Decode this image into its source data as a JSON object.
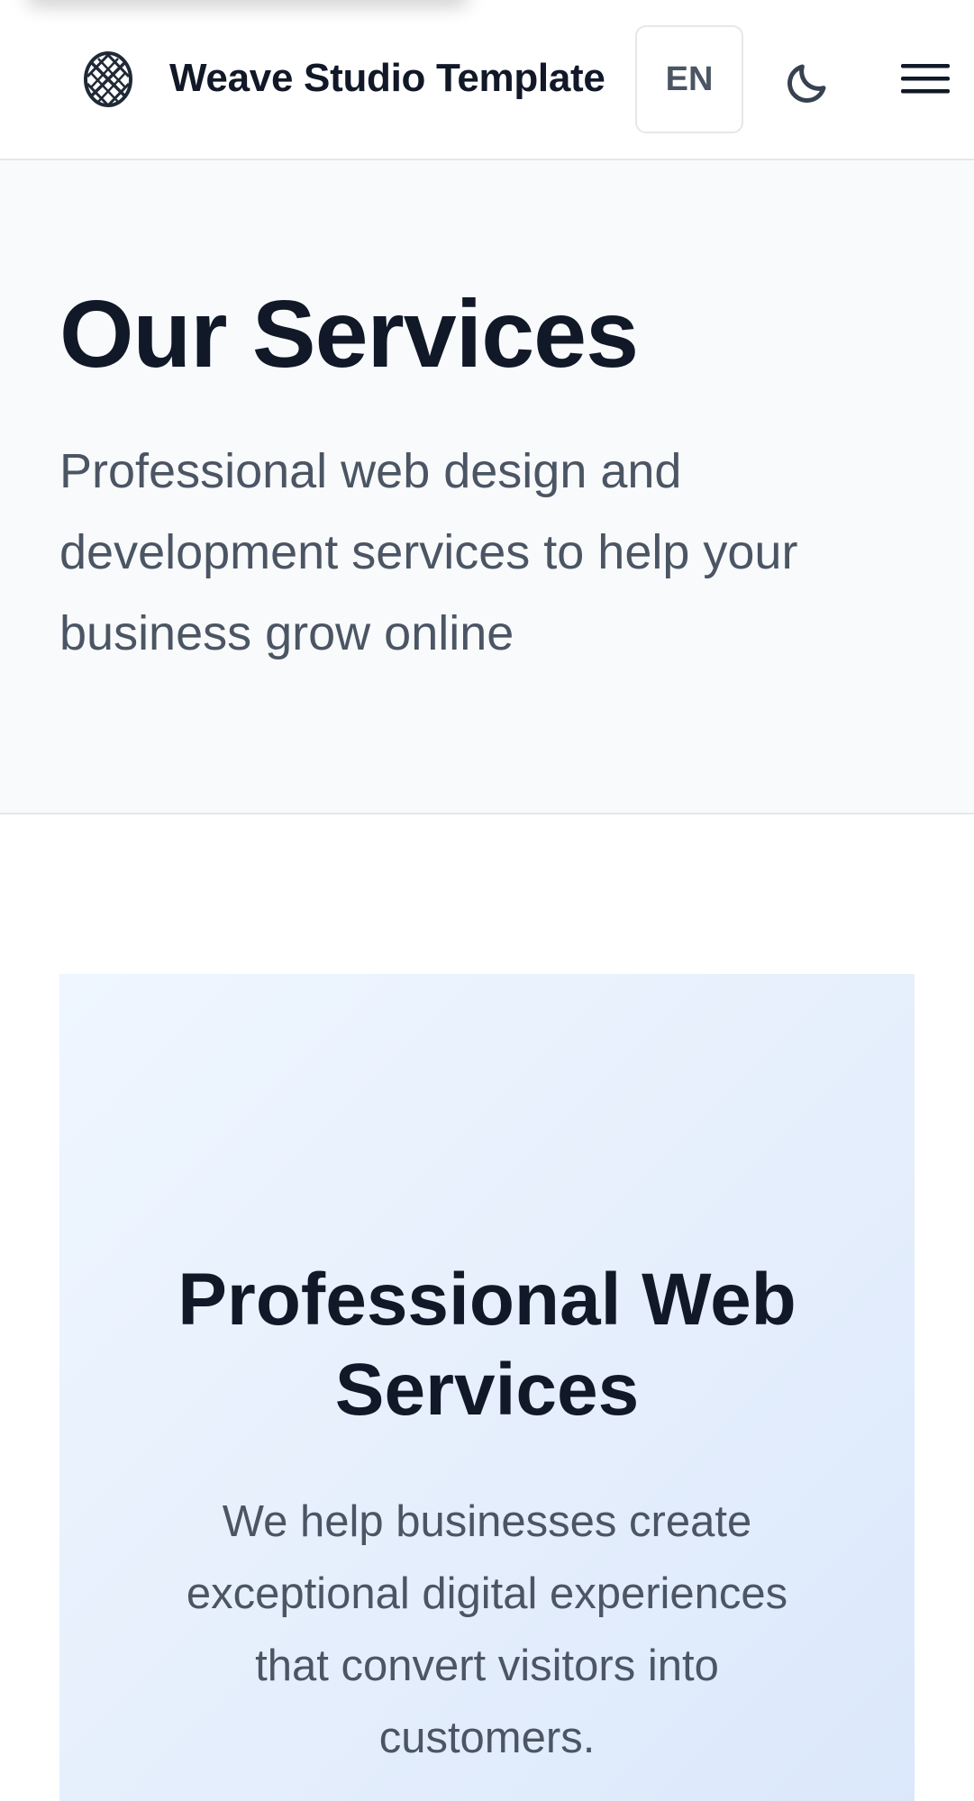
{
  "header": {
    "brand_title": "Weave Studio Template",
    "logo_icon": "woven-globe-icon",
    "language_label": "EN",
    "theme_icon": "moon-icon",
    "menu_icon": "hamburger-menu-icon"
  },
  "hero": {
    "title": "Our Services",
    "subtitle": "Professional web design and development services to help your business grow online"
  },
  "services_card": {
    "title": "Professional Web Services",
    "text": "We help businesses create exceptional digital experiences that convert visitors into customers."
  },
  "colors": {
    "text_primary": "#111827",
    "text_secondary": "#4b5563",
    "hero_background": "#f8fafc",
    "card_gradient_start": "#eff6ff",
    "card_gradient_end": "#dbe8fb"
  }
}
